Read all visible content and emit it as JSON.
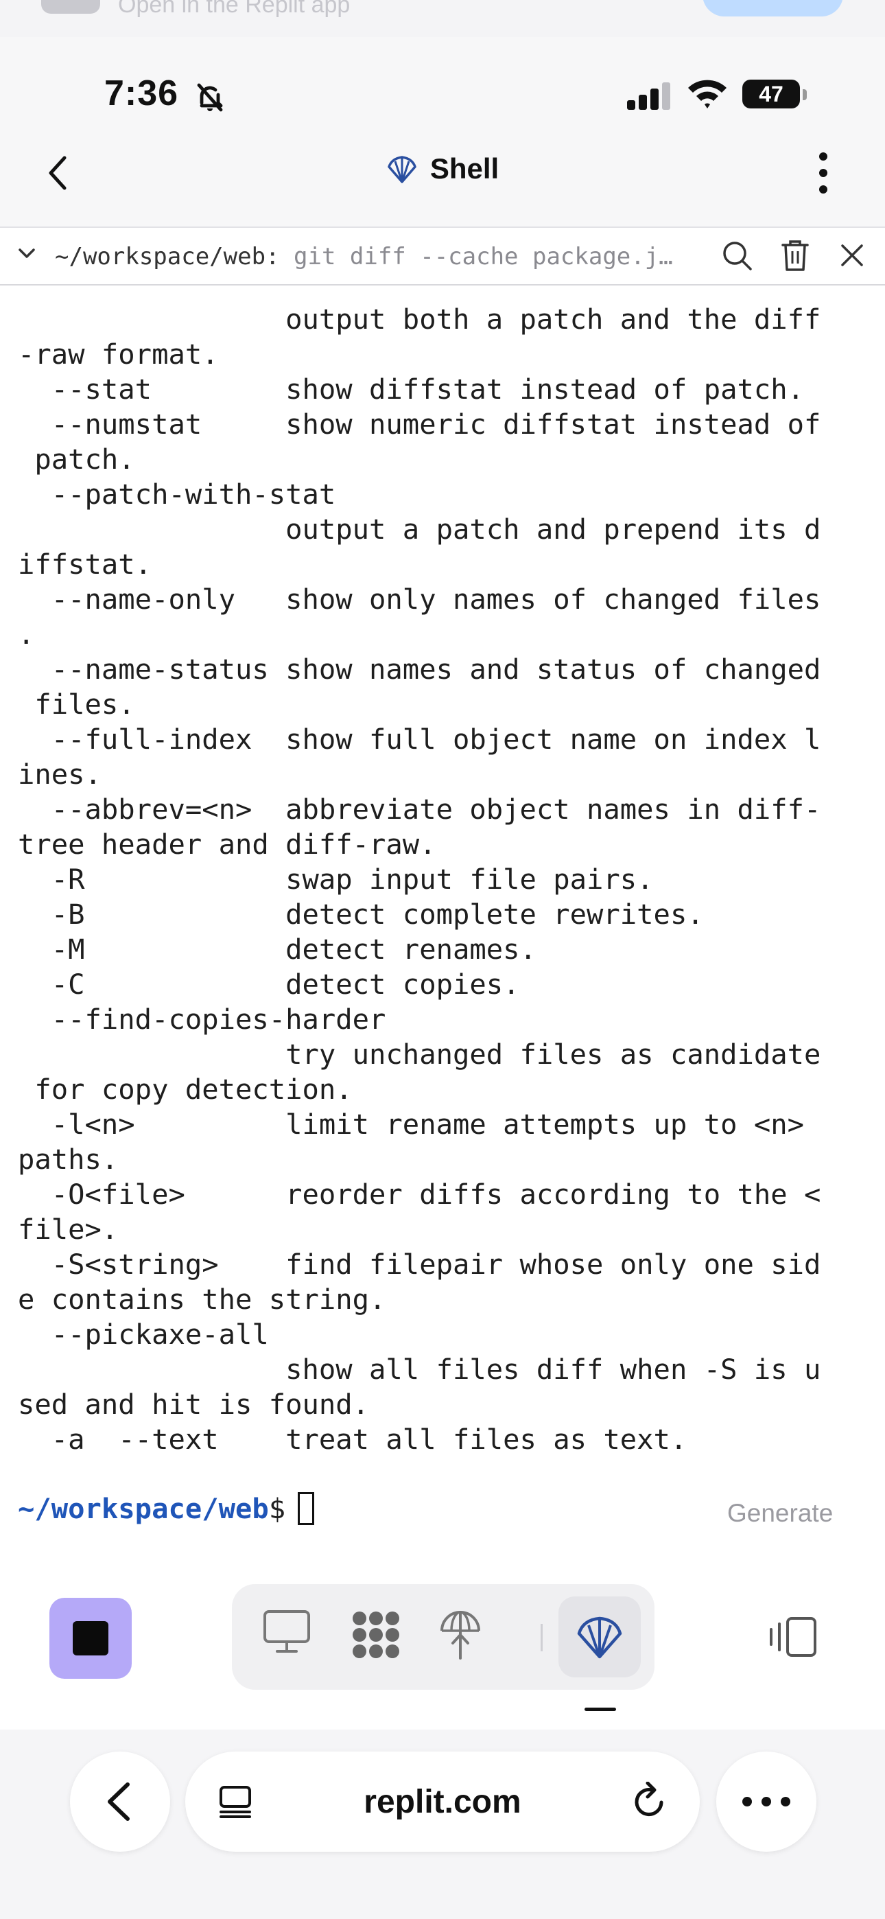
{
  "banner": {
    "text": "Open in the Replit app"
  },
  "status_bar": {
    "time": "7:36",
    "battery": "47"
  },
  "header": {
    "title": "Shell"
  },
  "shell_toolbar": {
    "path": "~/workspace/web:",
    "command": "git diff --cache package.j…"
  },
  "terminal": {
    "lines": [
      "                output both a patch and the diff",
      "-raw format.",
      "  --stat        show diffstat instead of patch.",
      "  --numstat     show numeric diffstat instead of",
      " patch.",
      "  --patch-with-stat",
      "                output a patch and prepend its d",
      "iffstat.",
      "  --name-only   show only names of changed files",
      ".",
      "  --name-status show names and status of changed",
      " files.",
      "  --full-index  show full object name on index l",
      "ines.",
      "  --abbrev=<n>  abbreviate object names in diff-",
      "tree header and diff-raw.",
      "  -R            swap input file pairs.",
      "  -B            detect complete rewrites.",
      "  -M            detect renames.",
      "  -C            detect copies.",
      "  --find-copies-harder",
      "                try unchanged files as candidate",
      " for copy detection.",
      "  -l<n>         limit rename attempts up to <n>",
      "paths.",
      "  -O<file>      reorder diffs according to the <",
      "file>.",
      "  -S<string>    find filepair whose only one sid",
      "e contains the string.",
      "  --pickaxe-all",
      "                show all files diff when -S is u",
      "sed and hit is found.",
      "  -a  --text    treat all files as text."
    ],
    "prompt_path": "~/workspace/web",
    "prompt_sign": "$",
    "generate_label": "Generate"
  },
  "browser": {
    "url": "replit.com"
  },
  "colors": {
    "accent_purple": "#b5a9f8",
    "prompt_blue": "#1f55b8",
    "replit_blue": "#2a4fa0"
  }
}
